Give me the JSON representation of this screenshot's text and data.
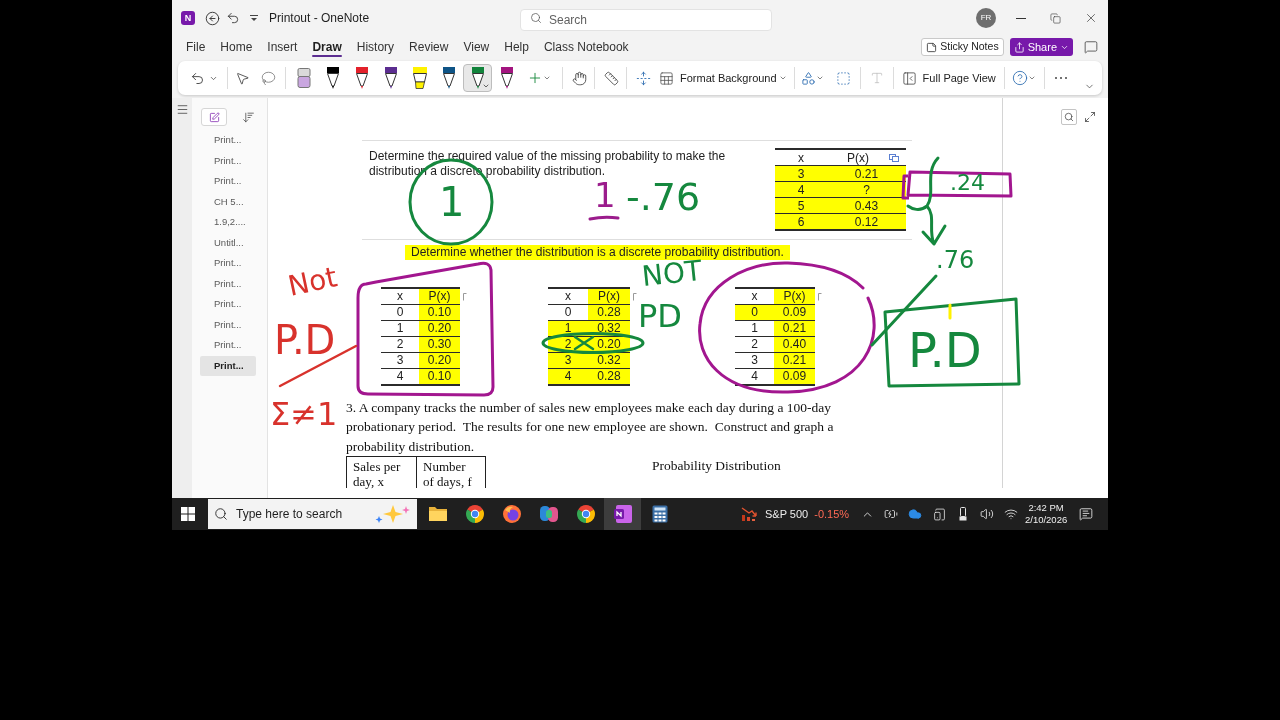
{
  "window": {
    "logo": "N",
    "title": "Printout - OneNote",
    "search": {
      "placeholder": "Search"
    },
    "avatar": "FR"
  },
  "menu": {
    "tabs": [
      {
        "label": "File",
        "selected": false
      },
      {
        "label": "Home",
        "selected": false
      },
      {
        "label": "Insert",
        "selected": false
      },
      {
        "label": "Draw",
        "selected": true
      },
      {
        "label": "History",
        "selected": false
      },
      {
        "label": "Review",
        "selected": false
      },
      {
        "label": "View",
        "selected": false
      },
      {
        "label": "Help",
        "selected": false
      },
      {
        "label": "Class Notebook",
        "selected": false
      }
    ],
    "sticky_notes": "Sticky Notes",
    "share": "Share"
  },
  "ribbon": {
    "pens": [
      {
        "kind": "eraser",
        "color": "#c9a6e0",
        "selected": false
      },
      {
        "kind": "pen",
        "color": "#000000",
        "selected": false
      },
      {
        "kind": "pen",
        "color": "#e3212b",
        "selected": false
      },
      {
        "kind": "pen",
        "color": "#5b2d90",
        "selected": false
      },
      {
        "kind": "highlighter",
        "color": "#fff200",
        "selected": false
      },
      {
        "kind": "pen",
        "color": "#0f5486",
        "selected": false
      },
      {
        "kind": "pen",
        "color": "#12843c",
        "selected": true
      },
      {
        "kind": "pen",
        "color": "#a3147f",
        "selected": false
      }
    ],
    "format_background": "Format Background",
    "full_page_view": "Full Page View"
  },
  "pages": [
    {
      "title": "Print...",
      "selected": false
    },
    {
      "title": "Print...",
      "selected": false
    },
    {
      "title": "Print...",
      "selected": false
    },
    {
      "title": "CH 5...",
      "selected": false
    },
    {
      "title": "1.9,2....",
      "selected": false
    },
    {
      "title": "Untitl...",
      "selected": false
    },
    {
      "title": "Print...",
      "selected": false
    },
    {
      "title": "Print...",
      "selected": false
    },
    {
      "title": "Print...",
      "selected": false
    },
    {
      "title": "Print...",
      "selected": false
    },
    {
      "title": "Print...",
      "selected": false
    },
    {
      "title": "Print...",
      "selected": true
    }
  ],
  "printout": {
    "question": "Determine the required value of the missing probability to make the distribution a discrete probability distribution.",
    "table": {
      "columns": [
        {
          "text": "x",
          "highlighted": false
        },
        {
          "text": "P(x)",
          "highlighted": false
        }
      ],
      "rows": [
        {
          "cells": [
            {
              "text": "3",
              "highlighted": true
            },
            {
              "text": "0.21",
              "highlighted": true
            }
          ]
        },
        {
          "cells": [
            {
              "text": "4",
              "highlighted": true
            },
            {
              "text": "?",
              "highlighted": true
            }
          ]
        },
        {
          "cells": [
            {
              "text": "5",
              "highlighted": true
            },
            {
              "text": "0.43",
              "highlighted": true
            }
          ]
        },
        {
          "cells": [
            {
              "text": "6",
              "highlighted": true
            },
            {
              "text": "0.12",
              "highlighted": true
            }
          ]
        }
      ]
    },
    "prompt": {
      "text": "Determine whether the distribution is a discrete probability distribution.",
      "highlighted": true
    },
    "tables": [
      {
        "columns": [
          {
            "text": "x",
            "highlighted": false
          },
          {
            "text": "P(x)",
            "highlighted": true
          }
        ],
        "rows": [
          {
            "cells": [
              {
                "text": "0",
                "highlighted": false
              },
              {
                "text": "0.10",
                "highlighted": true
              }
            ]
          },
          {
            "cells": [
              {
                "text": "1",
                "highlighted": false
              },
              {
                "text": "0.20",
                "highlighted": true
              }
            ]
          },
          {
            "cells": [
              {
                "text": "2",
                "highlighted": false
              },
              {
                "text": "0.30",
                "highlighted": true
              }
            ]
          },
          {
            "cells": [
              {
                "text": "3",
                "highlighted": false
              },
              {
                "text": "0.20",
                "highlighted": true
              }
            ]
          },
          {
            "cells": [
              {
                "text": "4",
                "highlighted": false
              },
              {
                "text": "0.10",
                "highlighted": true
              }
            ]
          }
        ]
      },
      {
        "columns": [
          {
            "text": "x",
            "highlighted": false
          },
          {
            "text": "P(x)",
            "highlighted": true
          }
        ],
        "rows": [
          {
            "cells": [
              {
                "text": "0",
                "highlighted": false
              },
              {
                "text": "0.28",
                "highlighted": true
              }
            ]
          },
          {
            "cells": [
              {
                "text": "1",
                "highlighted": true
              },
              {
                "text": "0.32",
                "highlighted": true
              }
            ]
          },
          {
            "cells": [
              {
                "text": "2",
                "highlighted": true
              },
              {
                "text": "0.20",
                "highlighted": true
              }
            ]
          },
          {
            "cells": [
              {
                "text": "3",
                "highlighted": true
              },
              {
                "text": "0.32",
                "highlighted": true
              }
            ]
          },
          {
            "cells": [
              {
                "text": "4",
                "highlighted": true
              },
              {
                "text": "0.28",
                "highlighted": true
              }
            ]
          }
        ]
      },
      {
        "columns": [
          {
            "text": "x",
            "highlighted": false
          },
          {
            "text": "P(x)",
            "highlighted": true
          }
        ],
        "rows": [
          {
            "cells": [
              {
                "text": "0",
                "highlighted": true
              },
              {
                "text": "0.09",
                "highlighted": true
              }
            ]
          },
          {
            "cells": [
              {
                "text": "1",
                "highlighted": false
              },
              {
                "text": "0.21",
                "highlighted": true
              }
            ]
          },
          {
            "cells": [
              {
                "text": "2",
                "highlighted": false
              },
              {
                "text": "0.40",
                "highlighted": true
              }
            ]
          },
          {
            "cells": [
              {
                "text": "3",
                "highlighted": false
              },
              {
                "text": "0.21",
                "highlighted": true
              }
            ]
          },
          {
            "cells": [
              {
                "text": "4",
                "highlighted": false
              },
              {
                "text": "0.09",
                "highlighted": true
              }
            ]
          }
        ]
      }
    ],
    "exercise": "3. A company tracks the number of sales new employees make each day during a 100-day probationary period.  The results for one new employee are shown.  Construct and graph a probability distribution.",
    "data_table": {
      "columns": [
        "Sales per day, x",
        "Number of days, f"
      ]
    },
    "chart_title": "Probability Distribution"
  },
  "ink": [
    {
      "text": "1",
      "color": "#15883e"
    },
    {
      "text": "1",
      "color": "#9b1c8c"
    },
    {
      "text": "-.76",
      "color": "#15883e"
    },
    {
      "text": ".24",
      "color": "#15883e"
    },
    {
      "text": ".76",
      "color": "#15883e"
    },
    {
      "text": "NOT",
      "color": "#15883e"
    },
    {
      "text": "PD",
      "color": "#15883e"
    },
    {
      "text": "P.D",
      "color": "#15883e"
    },
    {
      "text": "Not",
      "color": "#d8322c"
    },
    {
      "text": "P.D",
      "color": "#d8322c"
    },
    {
      "text": "Σ≠1",
      "color": "#d8322c"
    }
  ],
  "taskbar": {
    "search": {
      "placeholder": "Type here to search"
    },
    "apps": [
      {
        "kind": "folder",
        "selected": false
      },
      {
        "kind": "chrome",
        "selected": false
      },
      {
        "kind": "firefox",
        "selected": false
      },
      {
        "kind": "copilot",
        "selected": false
      },
      {
        "kind": "chrome",
        "selected": false
      },
      {
        "kind": "onenote",
        "selected": true
      },
      {
        "kind": "calculator",
        "selected": false
      }
    ],
    "stock": {
      "name": "S&P 500",
      "change": "-0.15%"
    },
    "clock": {
      "time": "2:42 PM",
      "date": "2/10/2026"
    }
  }
}
